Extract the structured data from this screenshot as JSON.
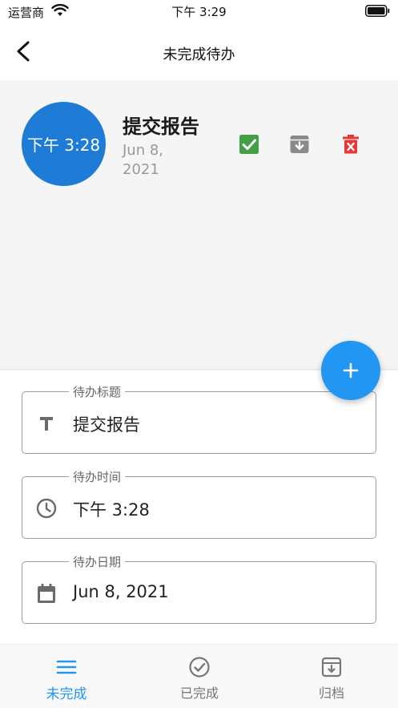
{
  "status_bar": {
    "carrier": "运营商",
    "time": "下午 3:29"
  },
  "nav": {
    "title": "未完成待办"
  },
  "todo": {
    "avatar_text": "下午 3:28",
    "title": "提交报告",
    "date": "Jun 8, 2021"
  },
  "form": {
    "title_field": {
      "label": "待办标题",
      "value": "提交报告"
    },
    "time_field": {
      "label": "待办时间",
      "value": "下午 3:28"
    },
    "date_field": {
      "label": "待办日期",
      "value": "Jun 8, 2021"
    }
  },
  "tabs": [
    {
      "label": "未完成",
      "icon": "menu-icon",
      "active": true
    },
    {
      "label": "已完成",
      "icon": "check-circle-icon",
      "active": false
    },
    {
      "label": "归档",
      "icon": "archive-icon",
      "active": false
    }
  ],
  "colors": {
    "accent": "#2196f3",
    "avatar": "#1e7bd6",
    "done": "#43a047",
    "archive": "#8a8a8a",
    "delete": "#e53935"
  }
}
